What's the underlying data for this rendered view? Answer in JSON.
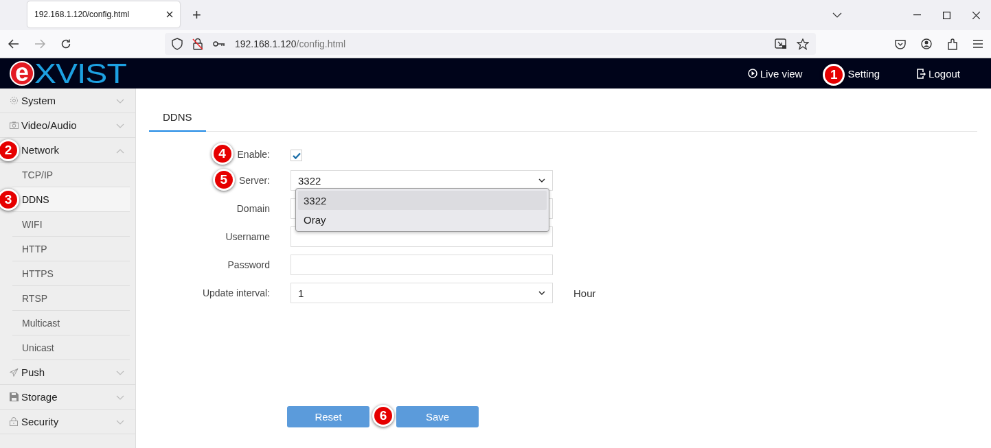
{
  "browser": {
    "tab_title": "192.168.1.120/config.html",
    "new_tab": "+",
    "url_host": "192.168.1.120",
    "url_path": "/config.html"
  },
  "header": {
    "logo_mark": "e",
    "logo_text": "XVIST",
    "nav": [
      {
        "label": "Live view",
        "kind": "play"
      },
      {
        "label": "Setting",
        "kind": "plain",
        "callout": "1"
      },
      {
        "label": "Logout",
        "kind": "logout"
      }
    ]
  },
  "sidebar": {
    "groups": [
      {
        "label": "System",
        "kind": "gear",
        "expanded": false
      },
      {
        "label": "Video/Audio",
        "kind": "camera",
        "expanded": false
      },
      {
        "label": "Network",
        "kind": "none",
        "expanded": true,
        "callout": "2",
        "children": [
          {
            "label": "TCP/IP",
            "selected": false
          },
          {
            "label": "DDNS",
            "selected": true,
            "callout": "3"
          },
          {
            "label": "WIFI",
            "selected": false
          },
          {
            "label": "HTTP",
            "selected": false
          },
          {
            "label": "HTTPS",
            "selected": false
          },
          {
            "label": "RTSP",
            "selected": false
          },
          {
            "label": "Multicast",
            "selected": false
          },
          {
            "label": "Unicast",
            "selected": false
          }
        ]
      },
      {
        "label": "Push",
        "kind": "send",
        "expanded": false
      },
      {
        "label": "Storage",
        "kind": "disk",
        "expanded": false
      },
      {
        "label": "Security",
        "kind": "lock",
        "expanded": false
      }
    ]
  },
  "tabs": [
    {
      "label": "DDNS",
      "selected": true
    }
  ],
  "form": {
    "fields": [
      {
        "label": "Enable:",
        "kind": "checkbox",
        "checked": true,
        "callout": "4"
      },
      {
        "label": "Server:",
        "kind": "select",
        "value": "3322",
        "callout": "5",
        "open": true,
        "options": [
          {
            "label": "3322",
            "selected": true
          },
          {
            "label": "Oray",
            "selected": false
          }
        ]
      },
      {
        "label": "Domain",
        "kind": "text"
      },
      {
        "label": "Username",
        "kind": "text"
      },
      {
        "label": "Password",
        "kind": "text"
      },
      {
        "label": "Update interval:",
        "kind": "select",
        "value": "1",
        "unit": "Hour"
      }
    ]
  },
  "buttons": [
    {
      "label": "Reset"
    },
    {
      "label": "Save",
      "callout": "6"
    }
  ]
}
